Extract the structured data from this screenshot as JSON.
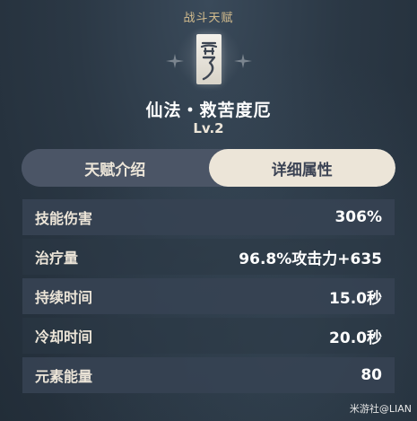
{
  "header": {
    "category": "战斗天赋"
  },
  "talent": {
    "icon": "talent-scroll-icon",
    "name": "仙法・救苦度厄",
    "level": "Lv.2"
  },
  "tabs": [
    {
      "label": "天赋介绍",
      "active": false
    },
    {
      "label": "详细属性",
      "active": true
    }
  ],
  "stats": [
    {
      "label": "技能伤害",
      "value": "306%"
    },
    {
      "label": "治疗量",
      "value": "96.8%攻击力+635"
    },
    {
      "label": "持续时间",
      "value": "15.0秒"
    },
    {
      "label": "冷却时间",
      "value": "20.0秒"
    },
    {
      "label": "元素能量",
      "value": "80"
    }
  ],
  "watermark": "米游社@LIAN",
  "colors": {
    "accent_gold": "#d3bc8e",
    "tab_active_bg": "#ece5d8",
    "tab_inactive_bg": "#4b5566",
    "background": "#2b3845"
  }
}
